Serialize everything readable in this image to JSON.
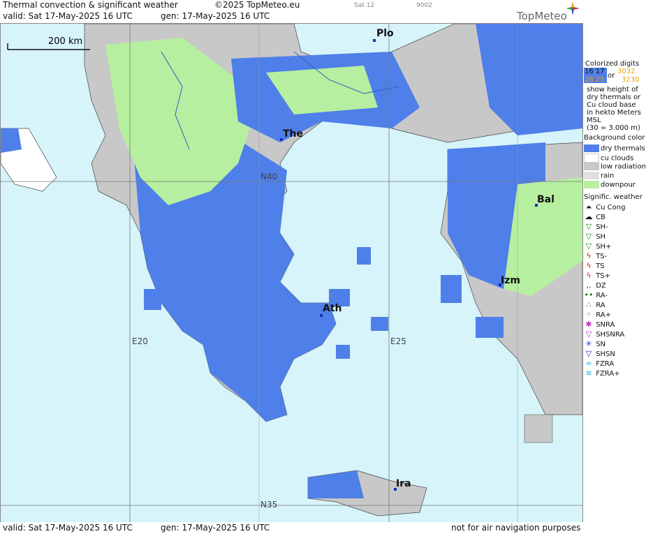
{
  "header": {
    "title": "Thermal convection & significant weather",
    "copyright": "©2025 TopMeteo.eu",
    "day_code": "Sat 12",
    "code": "9002",
    "valid": "valid:  Sat  17-May-2025  16 UTC",
    "gen": "gen: 17-May-2025 16 UTC",
    "brand": "TopMeteo"
  },
  "map": {
    "scale_label": "200 km",
    "grid_labels": [
      "N40",
      "E20",
      "E25",
      "N35"
    ],
    "cities": [
      "Plo",
      "The",
      "Bal",
      "Izm",
      "Ath",
      "Ira"
    ]
  },
  "legend": {
    "colorized_title": "Colorized digits",
    "sample_a": "16 17",
    "sample_b": "28 25",
    "sample_or": "or",
    "sample_c": "3032",
    "sample_d": "3230",
    "desc1": "show height of",
    "desc2": "dry thermals or",
    "desc3": "Cu cloud base",
    "desc4": "in hekto Meters",
    "desc5": "MSL",
    "desc6": "(30 = 3.000 m)",
    "bg_title": "Background color",
    "bg_items": [
      "dry thermals",
      "cu clouds",
      "low radiation",
      "rain",
      "downpour"
    ],
    "bg_colors": [
      "#4f7fe8",
      "#ffffff",
      "#c8c8c8",
      "#e0e0e0",
      "#b6efa0"
    ],
    "sig_title": "Signific. weather",
    "sig_items": [
      "Cu Cong",
      "CB",
      "SH-",
      "SH",
      "SH+",
      "TS-",
      "TS",
      "TS+",
      "DZ",
      "RA-",
      "RA",
      "RA+",
      "SNRA",
      "SHSNRA",
      "SN",
      "SHSN",
      "FZRA",
      "FZRA+"
    ]
  },
  "footer": {
    "valid": "valid:  Sat  17-May-2025  16 UTC",
    "gen": "gen: 17-May-2025 16 UTC",
    "disclaimer": "not for air navigation purposes"
  }
}
